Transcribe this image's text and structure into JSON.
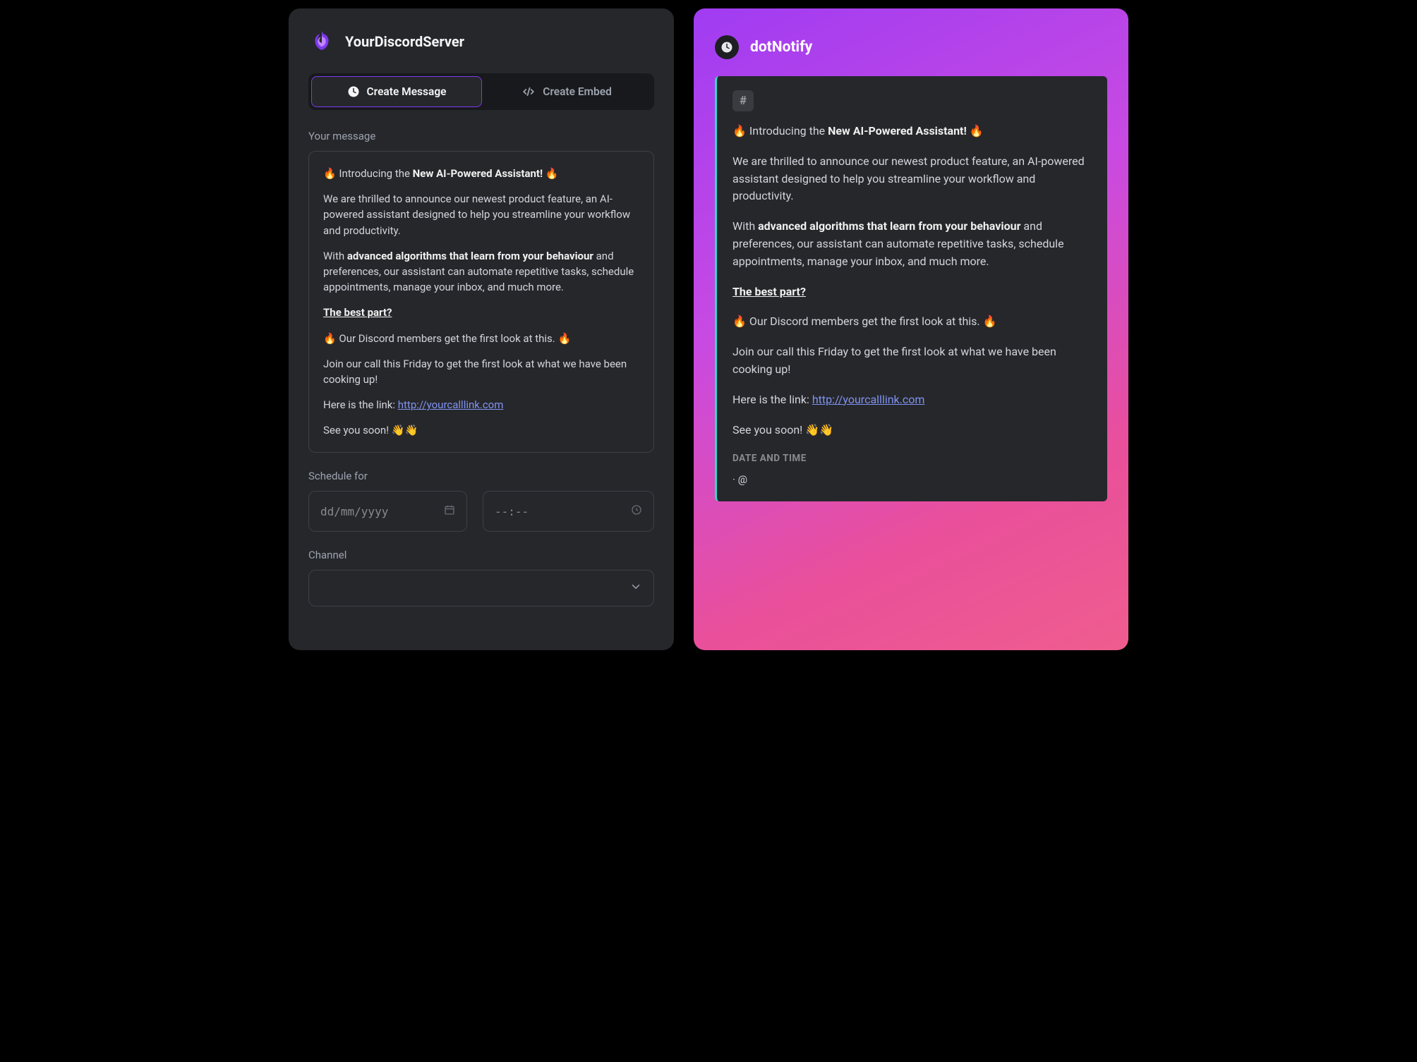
{
  "server": {
    "name": "YourDiscordServer"
  },
  "tabs": {
    "create_message": "Create Message",
    "create_embed": "Create Embed"
  },
  "labels": {
    "your_message": "Your message",
    "schedule_for": "Schedule for",
    "channel": "Channel"
  },
  "inputs": {
    "date_placeholder": "dd/mm/yyyy",
    "time_placeholder": "--:--"
  },
  "message": {
    "line1_pre": "🔥 Introducing the ",
    "line1_bold": "New AI-Powered Assistant!",
    "line1_post": " 🔥",
    "para2": "We are thrilled to announce our newest product feature, an AI-powered assistant designed to help you streamline your workflow and productivity.",
    "para3_pre": "With ",
    "para3_bold": "advanced algorithms that learn from your behaviour",
    "para3_post": " and preferences, our assistant can automate repetitive tasks, schedule appointments, manage your inbox, and much more.",
    "best_part": "The best part?",
    "para5": "🔥 Our Discord members get the first look at this. 🔥",
    "para6": "Join our call this Friday to get the first look at what we have been cooking up!",
    "link_pre": " Here is the link: ",
    "link_text": "http://yourcalllink.com",
    "see_you": " See you soon! 👋👋"
  },
  "preview": {
    "app_name": "dotNotify",
    "hash": "#",
    "date_time_label": "DATE AND TIME",
    "date_time_value": " · @"
  }
}
